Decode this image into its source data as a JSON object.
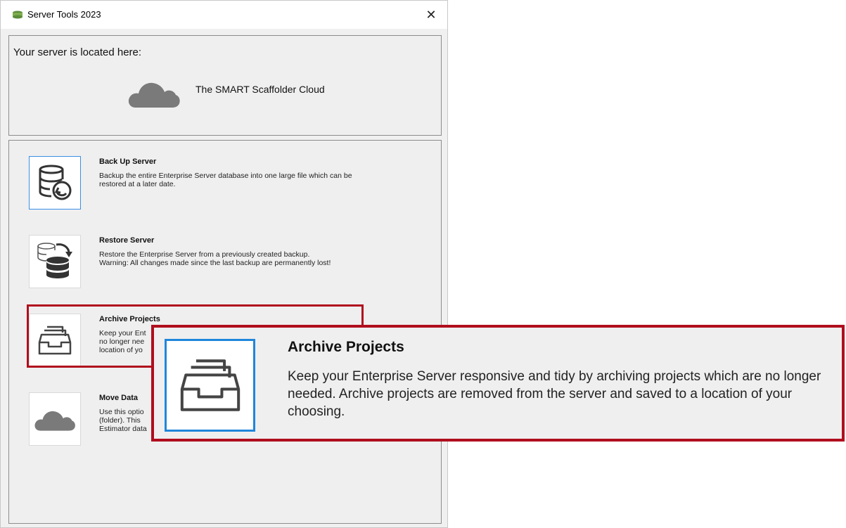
{
  "window": {
    "title": "Server Tools 2023",
    "close_glyph": "✕"
  },
  "location": {
    "label": "Your server is located here:",
    "server_name": "The SMART Scaffolder Cloud"
  },
  "tools": [
    {
      "title": "Back Up Server",
      "description": "Backup the entire Enterprise Server database into one large file which can be\nrestored at a later date.",
      "icon": "database-backup-icon"
    },
    {
      "title": "Restore Server",
      "description": "Restore the Enterprise Server from a previously created backup.\nWarning: All changes made since the last backup are permanently lost!",
      "icon": "database-restore-icon"
    },
    {
      "title": "Archive Projects",
      "description": "Keep your Ent\nno longer nee\nlocation of yo",
      "icon": "archive-tray-icon"
    },
    {
      "title": "Move Data",
      "description": "Use this optio\n(folder). This\nEstimator data",
      "icon": "cloud-icon"
    }
  ],
  "callout": {
    "title": "Archive Projects",
    "description": "Keep your Enterprise Server responsive and tidy by archiving projects which are no longer needed. Archive projects are removed from the server and saved to a location of your choosing."
  },
  "colors": {
    "highlight": "#b00e1e",
    "selection": "#1f86db",
    "cloud": "#7a7a7a"
  }
}
